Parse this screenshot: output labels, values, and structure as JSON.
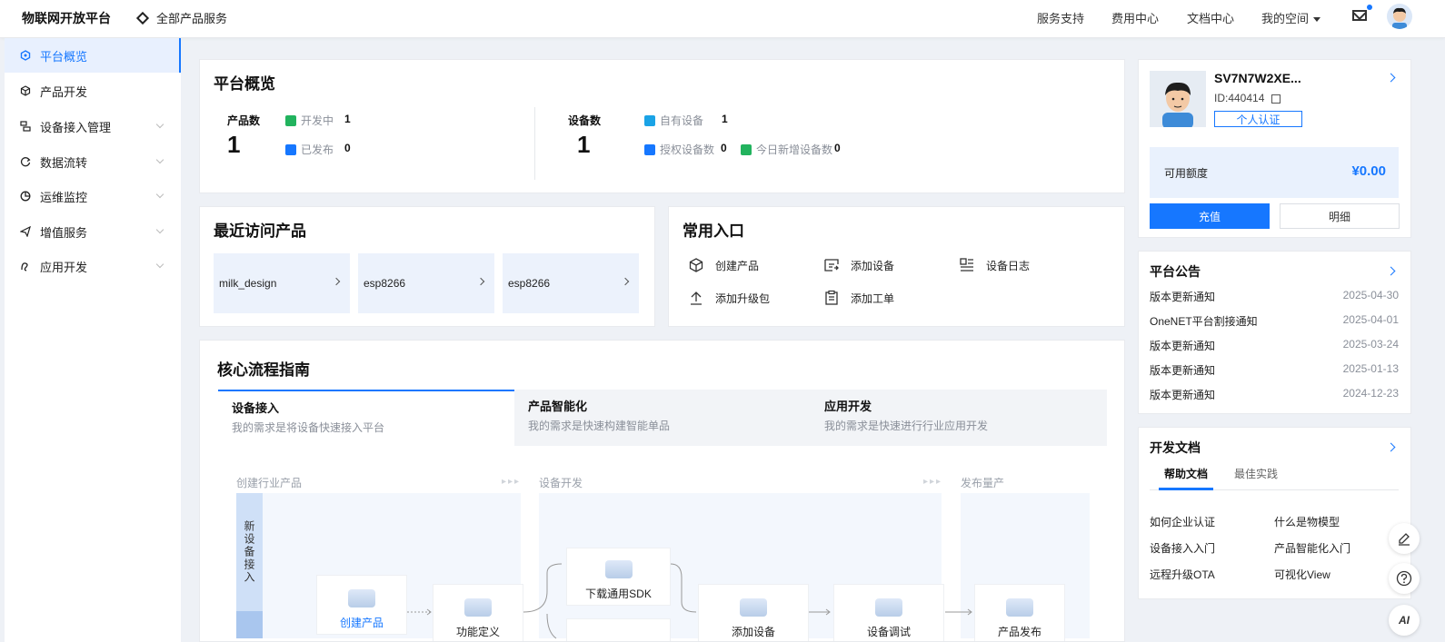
{
  "topbar": {
    "brand": "物联网开放平台",
    "all_products": "全部产品服务",
    "links": [
      "服务支持",
      "费用中心",
      "文档中心"
    ],
    "my_space": "我的空间"
  },
  "sidebar": {
    "items": [
      {
        "label": "平台概览",
        "icon": "hexagon-icon"
      },
      {
        "label": "产品开发",
        "icon": "cube-icon"
      },
      {
        "label": "设备接入管理",
        "icon": "device-icon"
      },
      {
        "label": "数据流转",
        "icon": "flow-icon"
      },
      {
        "label": "运维监控",
        "icon": "pie-icon"
      },
      {
        "label": "增值服务",
        "icon": "send-icon"
      },
      {
        "label": "应用开发",
        "icon": "app-icon"
      }
    ]
  },
  "overview": {
    "title": "平台概览",
    "products": {
      "label": "产品数",
      "total": "1",
      "developing_label": "开发中",
      "developing": "1",
      "published_label": "已发布",
      "published": "0"
    },
    "devices": {
      "label": "设备数",
      "total": "1",
      "own_label": "自有设备",
      "own": "1",
      "auth_label": "授权设备数",
      "auth": "0",
      "new_today_label": "今日新增设备数",
      "new_today": "0"
    }
  },
  "recent": {
    "title": "最近访问产品",
    "items": [
      "milk_design",
      "esp8266",
      "esp8266"
    ]
  },
  "shortcuts": {
    "title": "常用入口",
    "items": [
      "创建产品",
      "添加设备",
      "设备日志",
      "添加升级包",
      "添加工单"
    ]
  },
  "core": {
    "title": "核心流程指南",
    "tabs": [
      {
        "title": "设备接入",
        "sub": "我的需求是将设备快速接入平台"
      },
      {
        "title": "产品智能化",
        "sub": "我的需求是快速构建智能单品"
      },
      {
        "title": "应用开发",
        "sub": "我的需求是快速进行行业应用开发"
      }
    ],
    "phases": [
      "创建行业产品",
      "设备开发",
      "发布量产"
    ],
    "lane": "新设备接入",
    "nodes": [
      "创建产品",
      "功能定义",
      "下载通用SDK",
      "添加设备",
      "设备调试",
      "产品发布"
    ]
  },
  "account": {
    "name": "SV7N7W2XE...",
    "id": "ID:440414",
    "verify": "个人认证",
    "balance_label": "可用额度",
    "balance": "¥0.00",
    "recharge": "充值",
    "detail": "明细"
  },
  "notices": {
    "title": "平台公告",
    "items": [
      {
        "text": "版本更新通知",
        "date": "2025-04-30"
      },
      {
        "text": "OneNET平台割接通知",
        "date": "2025-04-01"
      },
      {
        "text": "版本更新通知",
        "date": "2025-03-24"
      },
      {
        "text": "版本更新通知",
        "date": "2025-01-13"
      },
      {
        "text": "版本更新通知",
        "date": "2024-12-23"
      }
    ]
  },
  "docs": {
    "title": "开发文档",
    "tabs": [
      "帮助文档",
      "最佳实践"
    ],
    "links": [
      "如何企业认证",
      "什么是物模型",
      "设备接入入门",
      "产品智能化入门",
      "远程升级OTA",
      "可视化View"
    ]
  },
  "floating": {
    "ai": "AI"
  },
  "colors": {
    "accent": "#1677ff",
    "background": "#eef1f6"
  }
}
